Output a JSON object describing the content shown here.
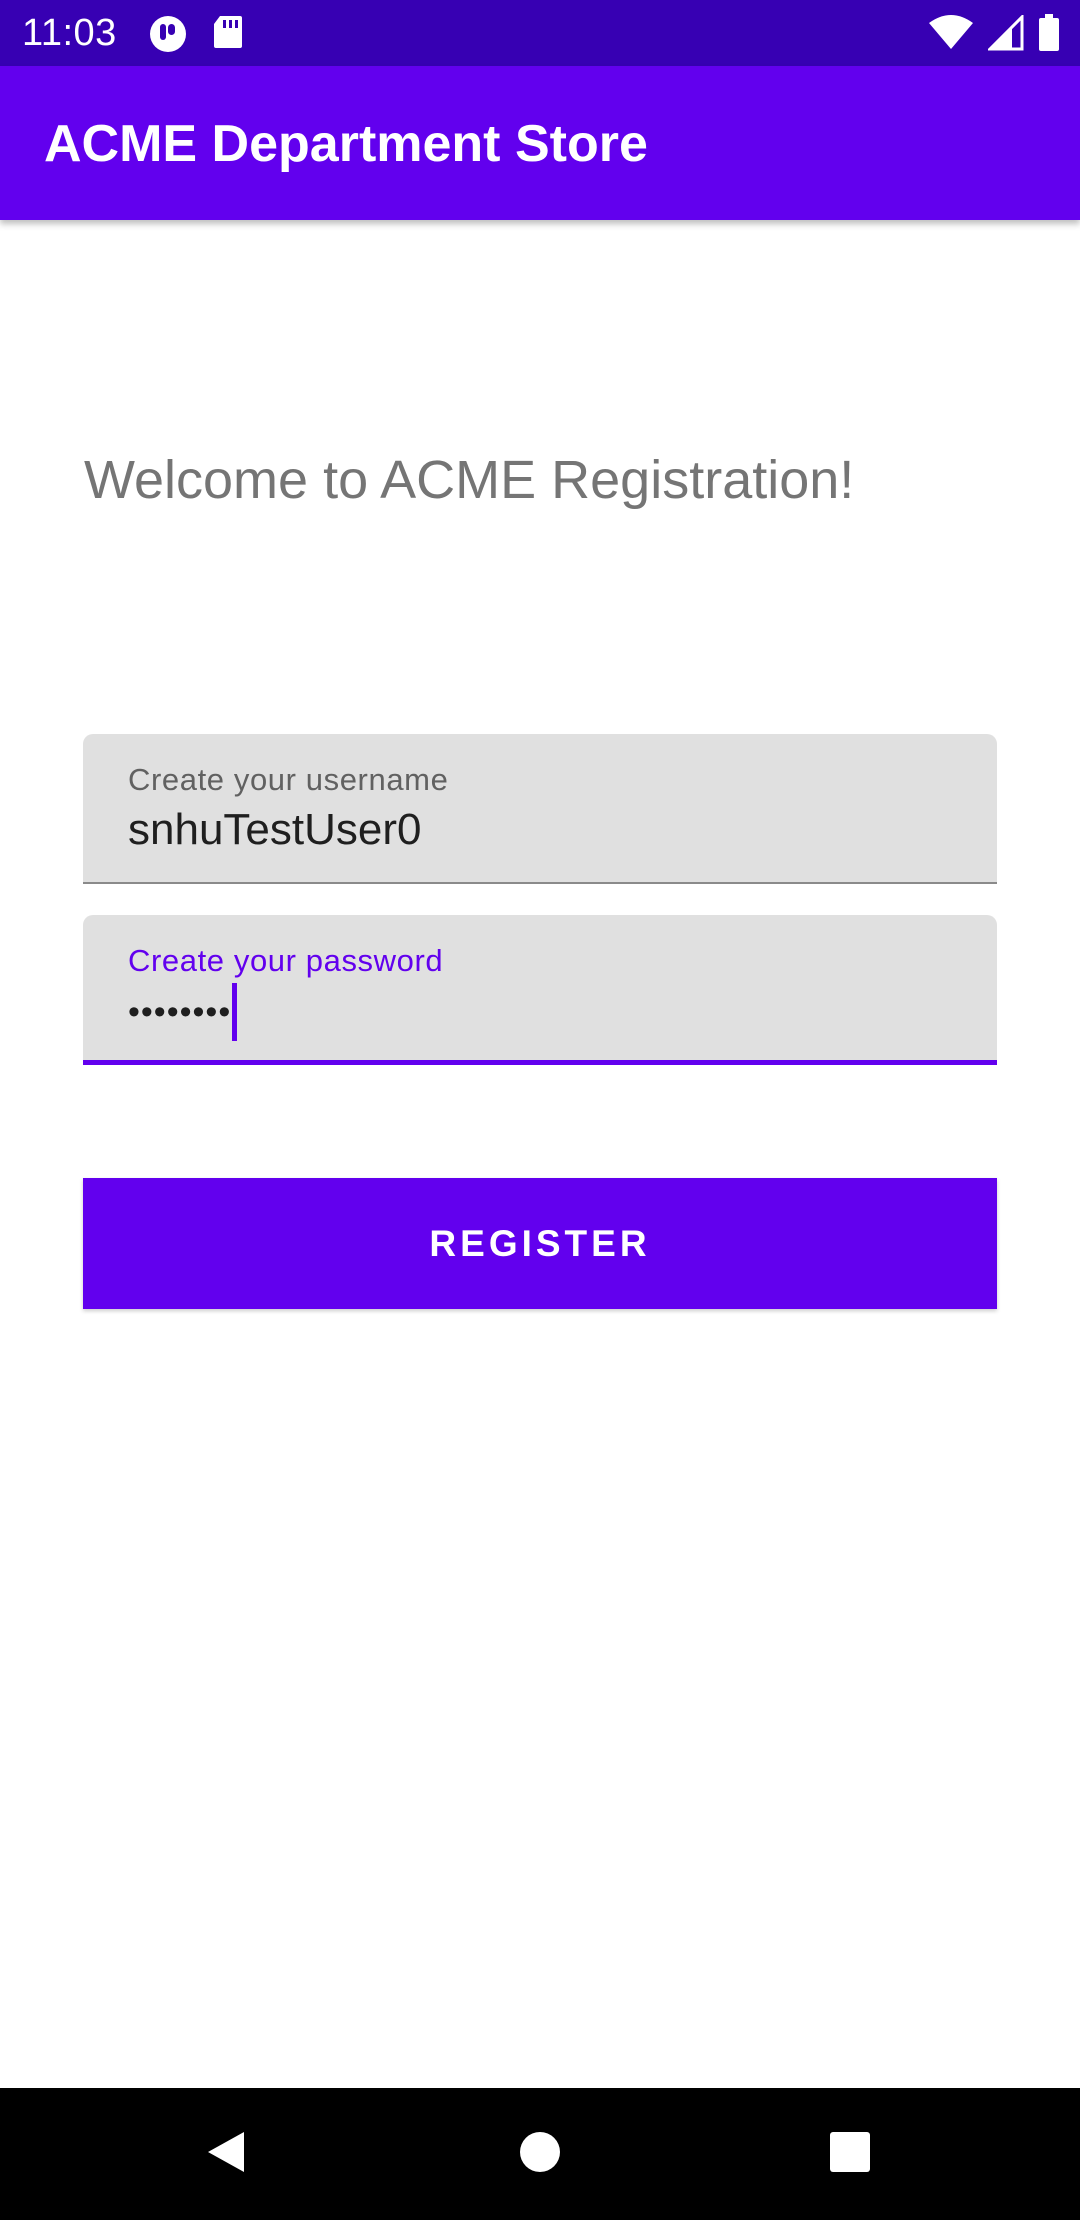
{
  "status_bar": {
    "time": "11:03",
    "left_icons": [
      "app-notification-icon",
      "sd-card-icon"
    ],
    "right_icons": [
      "wifi-icon",
      "cell-signal-icon",
      "battery-icon"
    ]
  },
  "app_bar": {
    "title": "ACME Department Store"
  },
  "main": {
    "welcome_text": "Welcome to ACME Registration!",
    "username_field": {
      "label": "Create your username",
      "value": "snhuTestUser0"
    },
    "password_field": {
      "label": "Create your password",
      "masked_value": "••••••••",
      "focused": true
    },
    "register_button": {
      "label": "REGISTER"
    }
  },
  "nav_bar": {
    "buttons": [
      "back-icon",
      "home-icon",
      "recents-icon"
    ]
  },
  "colors": {
    "status_bar": "#3700b3",
    "primary": "#6200ee",
    "field_background": "#e0e0e0",
    "welcome_text": "#757575"
  }
}
